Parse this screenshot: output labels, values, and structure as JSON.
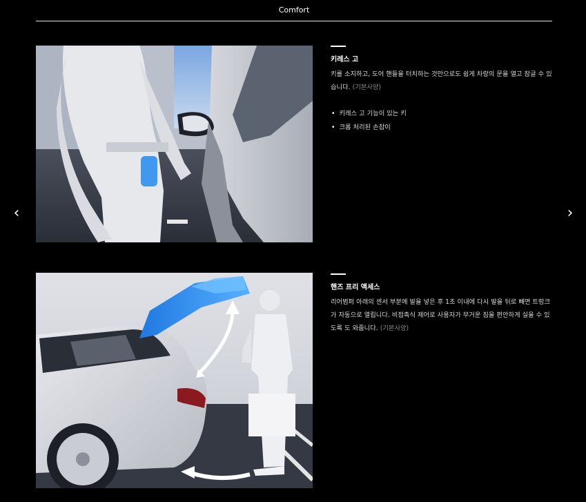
{
  "header": {
    "title": "Comfort"
  },
  "nav": {
    "prev_icon": "‹",
    "next_icon": "›"
  },
  "features": [
    {
      "title": "키레스 고",
      "description": "키를 소지하고, 도어 핸들을 터치하는 것만으로도 쉽게 차량의 문을 열고 잠글 수 있습니다.",
      "note": "(기본사양)",
      "bullets": [
        "키레스 고 기능이 있는 키",
        "크롬 처리된 손잡이"
      ]
    },
    {
      "title": "핸즈 프리 액세스",
      "description": "리어범퍼 아래의 센서 부분에 발을 넣은 후 1초 이내에 다시 발을 뒤로 빼면 트렁크가 자동으로 열립니다. 비접촉식 제어로 사용자가 무거운 짐을 편안하게 실을 수 있도록 도 와줍니다.",
      "note": "(기본사양)"
    }
  ],
  "colors": {
    "background": "#000000",
    "text": "#ffffff",
    "highlight_blue": "#2f8ff0"
  }
}
